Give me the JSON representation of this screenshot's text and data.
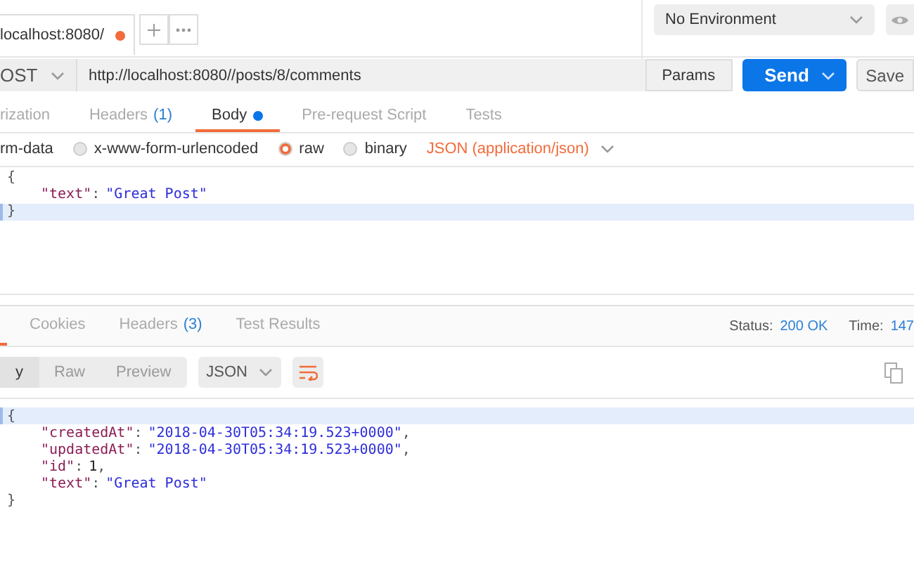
{
  "request_tab": {
    "label": "localhost:8080/",
    "unsaved": true
  },
  "environment": {
    "value": "No Environment"
  },
  "request": {
    "method": "OST",
    "url": "http://localhost:8080//posts/8/comments",
    "params": "Params",
    "send": "Send",
    "save": "Save"
  },
  "request_tabs": [
    {
      "label": "rization",
      "selected": false,
      "dot": false
    },
    {
      "label": "Headers",
      "count": "(1)",
      "selected": false,
      "dot": false
    },
    {
      "label": "Body",
      "selected": true,
      "dot": true
    },
    {
      "label": "Pre-request Script",
      "selected": false,
      "dot": false
    },
    {
      "label": "Tests",
      "selected": false,
      "dot": false
    }
  ],
  "body_types": [
    {
      "label": "rm-data",
      "kind": "partial"
    },
    {
      "label": "x-www-form-urlencoded",
      "kind": "radio",
      "selected": false
    },
    {
      "label": "raw",
      "kind": "radio",
      "selected": true
    },
    {
      "label": "binary",
      "kind": "radio",
      "selected": false
    }
  ],
  "content_type": "JSON (application/json)",
  "request_body": [
    {
      "highlighted": false,
      "tokens": [
        {
          "kind": "punct",
          "text": "{"
        }
      ],
      "children": [
        {
          "highlighted": false,
          "tokens": [
            {
              "kind": "key",
              "text": "\"text\""
            },
            {
              "kind": "punct",
              "text": ":"
            },
            {
              "kind": "string",
              "text": "\"Great Post\""
            }
          ]
        }
      ]
    },
    {
      "highlighted": true,
      "tokens": [
        {
          "kind": "punct",
          "text": "}"
        }
      ]
    }
  ],
  "response_tabs": [
    {
      "label": "Cookies",
      "selected": false
    },
    {
      "label": "Headers",
      "count": "(3)",
      "selected": false
    },
    {
      "label": "Test Results",
      "selected": false
    }
  ],
  "status": {
    "label": "Status:",
    "value": "200 OK",
    "time_label": "Time:",
    "time_value": "147"
  },
  "view_modes": [
    {
      "label": "y",
      "selected": true
    },
    {
      "label": "Raw",
      "selected": false
    },
    {
      "label": "Preview",
      "selected": false
    }
  ],
  "format": "JSON",
  "response_body": [
    {
      "highlighted": true,
      "tokens": [
        {
          "kind": "punct",
          "text": "{"
        }
      ],
      "children": [
        {
          "highlighted": false,
          "tokens": [
            {
              "kind": "key",
              "text": "\"createdAt\""
            },
            {
              "kind": "punct",
              "text": ":"
            },
            {
              "kind": "string",
              "text": "\"2018-04-30T05:34:19.523+0000\""
            },
            {
              "kind": "punct",
              "text": ","
            }
          ]
        },
        {
          "highlighted": false,
          "tokens": [
            {
              "kind": "key",
              "text": "\"updatedAt\""
            },
            {
              "kind": "punct",
              "text": ":"
            },
            {
              "kind": "string",
              "text": "\"2018-04-30T05:34:19.523+0000\""
            },
            {
              "kind": "punct",
              "text": ","
            }
          ]
        },
        {
          "highlighted": false,
          "tokens": [
            {
              "kind": "key",
              "text": "\"id\""
            },
            {
              "kind": "punct",
              "text": ":"
            },
            {
              "kind": "number",
              "text": "1"
            },
            {
              "kind": "punct",
              "text": ","
            }
          ]
        },
        {
          "highlighted": false,
          "tokens": [
            {
              "kind": "key",
              "text": "\"text\""
            },
            {
              "kind": "punct",
              "text": ":"
            },
            {
              "kind": "string",
              "text": "\"Great Post\""
            }
          ]
        }
      ]
    },
    {
      "highlighted": false,
      "tokens": [
        {
          "kind": "punct",
          "text": "}"
        }
      ]
    }
  ]
}
